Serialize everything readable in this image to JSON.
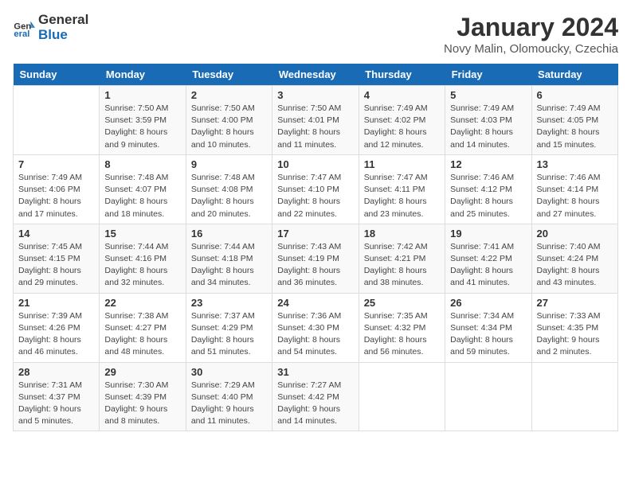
{
  "logo": {
    "line1": "General",
    "line2": "Blue"
  },
  "title": "January 2024",
  "subtitle": "Novy Malin, Olomoucky, Czechia",
  "days_header": [
    "Sunday",
    "Monday",
    "Tuesday",
    "Wednesday",
    "Thursday",
    "Friday",
    "Saturday"
  ],
  "weeks": [
    [
      {
        "num": "",
        "info": ""
      },
      {
        "num": "1",
        "info": "Sunrise: 7:50 AM\nSunset: 3:59 PM\nDaylight: 8 hours\nand 9 minutes."
      },
      {
        "num": "2",
        "info": "Sunrise: 7:50 AM\nSunset: 4:00 PM\nDaylight: 8 hours\nand 10 minutes."
      },
      {
        "num": "3",
        "info": "Sunrise: 7:50 AM\nSunset: 4:01 PM\nDaylight: 8 hours\nand 11 minutes."
      },
      {
        "num": "4",
        "info": "Sunrise: 7:49 AM\nSunset: 4:02 PM\nDaylight: 8 hours\nand 12 minutes."
      },
      {
        "num": "5",
        "info": "Sunrise: 7:49 AM\nSunset: 4:03 PM\nDaylight: 8 hours\nand 14 minutes."
      },
      {
        "num": "6",
        "info": "Sunrise: 7:49 AM\nSunset: 4:05 PM\nDaylight: 8 hours\nand 15 minutes."
      }
    ],
    [
      {
        "num": "7",
        "info": "Sunrise: 7:49 AM\nSunset: 4:06 PM\nDaylight: 8 hours\nand 17 minutes."
      },
      {
        "num": "8",
        "info": "Sunrise: 7:48 AM\nSunset: 4:07 PM\nDaylight: 8 hours\nand 18 minutes."
      },
      {
        "num": "9",
        "info": "Sunrise: 7:48 AM\nSunset: 4:08 PM\nDaylight: 8 hours\nand 20 minutes."
      },
      {
        "num": "10",
        "info": "Sunrise: 7:47 AM\nSunset: 4:10 PM\nDaylight: 8 hours\nand 22 minutes."
      },
      {
        "num": "11",
        "info": "Sunrise: 7:47 AM\nSunset: 4:11 PM\nDaylight: 8 hours\nand 23 minutes."
      },
      {
        "num": "12",
        "info": "Sunrise: 7:46 AM\nSunset: 4:12 PM\nDaylight: 8 hours\nand 25 minutes."
      },
      {
        "num": "13",
        "info": "Sunrise: 7:46 AM\nSunset: 4:14 PM\nDaylight: 8 hours\nand 27 minutes."
      }
    ],
    [
      {
        "num": "14",
        "info": "Sunrise: 7:45 AM\nSunset: 4:15 PM\nDaylight: 8 hours\nand 29 minutes."
      },
      {
        "num": "15",
        "info": "Sunrise: 7:44 AM\nSunset: 4:16 PM\nDaylight: 8 hours\nand 32 minutes."
      },
      {
        "num": "16",
        "info": "Sunrise: 7:44 AM\nSunset: 4:18 PM\nDaylight: 8 hours\nand 34 minutes."
      },
      {
        "num": "17",
        "info": "Sunrise: 7:43 AM\nSunset: 4:19 PM\nDaylight: 8 hours\nand 36 minutes."
      },
      {
        "num": "18",
        "info": "Sunrise: 7:42 AM\nSunset: 4:21 PM\nDaylight: 8 hours\nand 38 minutes."
      },
      {
        "num": "19",
        "info": "Sunrise: 7:41 AM\nSunset: 4:22 PM\nDaylight: 8 hours\nand 41 minutes."
      },
      {
        "num": "20",
        "info": "Sunrise: 7:40 AM\nSunset: 4:24 PM\nDaylight: 8 hours\nand 43 minutes."
      }
    ],
    [
      {
        "num": "21",
        "info": "Sunrise: 7:39 AM\nSunset: 4:26 PM\nDaylight: 8 hours\nand 46 minutes."
      },
      {
        "num": "22",
        "info": "Sunrise: 7:38 AM\nSunset: 4:27 PM\nDaylight: 8 hours\nand 48 minutes."
      },
      {
        "num": "23",
        "info": "Sunrise: 7:37 AM\nSunset: 4:29 PM\nDaylight: 8 hours\nand 51 minutes."
      },
      {
        "num": "24",
        "info": "Sunrise: 7:36 AM\nSunset: 4:30 PM\nDaylight: 8 hours\nand 54 minutes."
      },
      {
        "num": "25",
        "info": "Sunrise: 7:35 AM\nSunset: 4:32 PM\nDaylight: 8 hours\nand 56 minutes."
      },
      {
        "num": "26",
        "info": "Sunrise: 7:34 AM\nSunset: 4:34 PM\nDaylight: 8 hours\nand 59 minutes."
      },
      {
        "num": "27",
        "info": "Sunrise: 7:33 AM\nSunset: 4:35 PM\nDaylight: 9 hours\nand 2 minutes."
      }
    ],
    [
      {
        "num": "28",
        "info": "Sunrise: 7:31 AM\nSunset: 4:37 PM\nDaylight: 9 hours\nand 5 minutes."
      },
      {
        "num": "29",
        "info": "Sunrise: 7:30 AM\nSunset: 4:39 PM\nDaylight: 9 hours\nand 8 minutes."
      },
      {
        "num": "30",
        "info": "Sunrise: 7:29 AM\nSunset: 4:40 PM\nDaylight: 9 hours\nand 11 minutes."
      },
      {
        "num": "31",
        "info": "Sunrise: 7:27 AM\nSunset: 4:42 PM\nDaylight: 9 hours\nand 14 minutes."
      },
      {
        "num": "",
        "info": ""
      },
      {
        "num": "",
        "info": ""
      },
      {
        "num": "",
        "info": ""
      }
    ]
  ]
}
